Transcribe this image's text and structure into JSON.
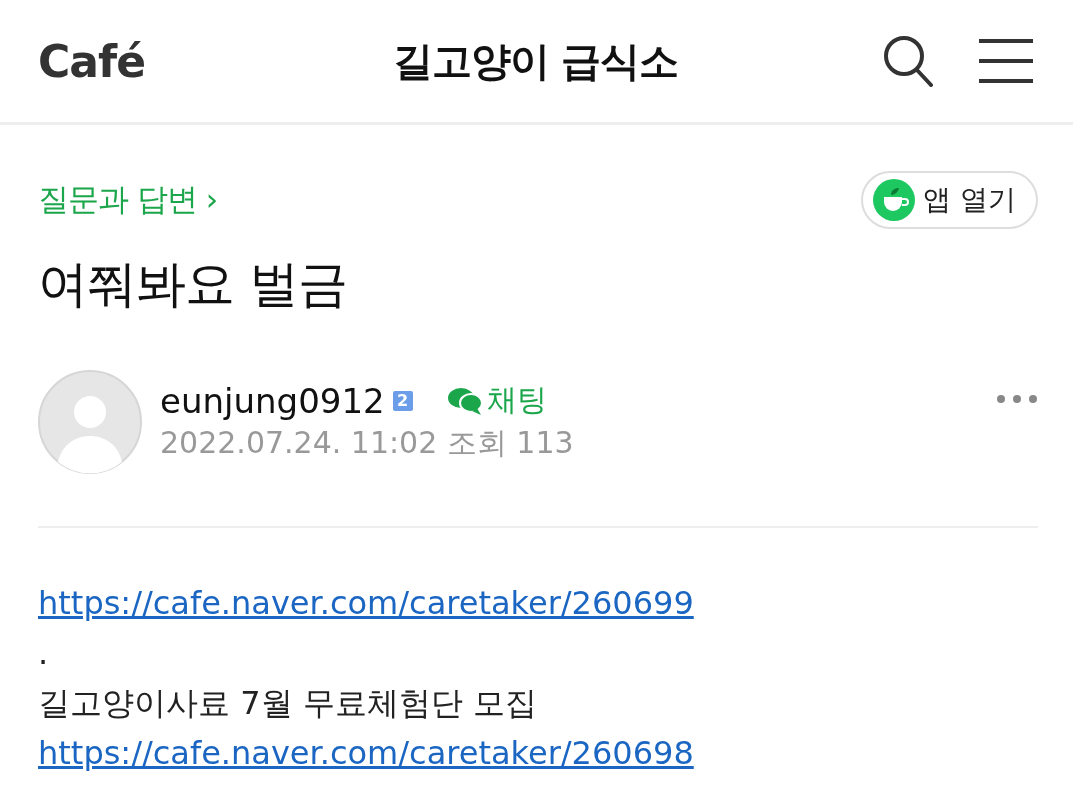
{
  "header": {
    "logo": "Café",
    "title": "길고양이 급식소"
  },
  "board": {
    "name": "질문과 답변",
    "chevron": "›"
  },
  "app_button": {
    "label": "앱 열기"
  },
  "post": {
    "title": "여쭤봐요 벌금",
    "author": {
      "name": "eunjung0912",
      "level_badge": "2",
      "chat_label": "채팅"
    },
    "date": "2022.07.24. 11:02",
    "views_label": "조회",
    "views": "113",
    "body": [
      {
        "kind": "link",
        "text": "https://cafe.naver.com/caretaker/260699"
      },
      {
        "kind": "text",
        "text": "."
      },
      {
        "kind": "text",
        "text": "길고양이사료 7월 무료체험단 모집"
      },
      {
        "kind": "link",
        "text": "https://cafe.naver.com/caretaker/260698"
      }
    ]
  }
}
